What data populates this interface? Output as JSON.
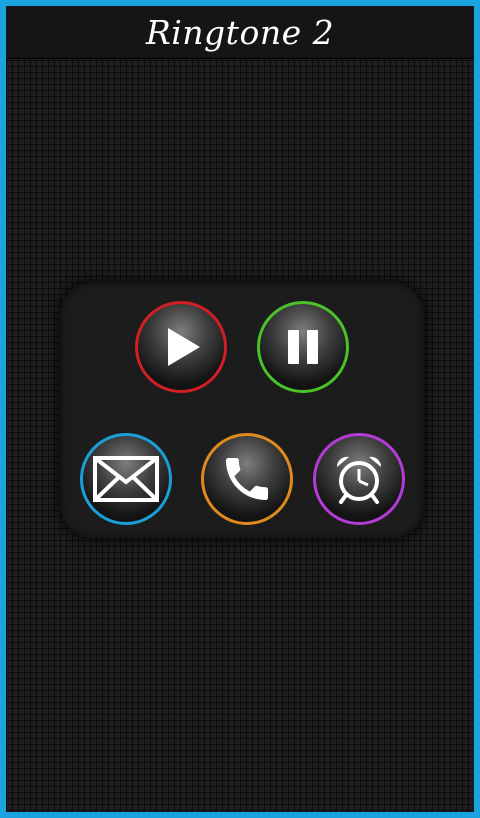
{
  "header": {
    "title": "Ringtone 2"
  },
  "colors": {
    "frame_border": "#1aa3df",
    "play_ring": "#d11f26",
    "pause_ring": "#4bc22a",
    "message_ring": "#1a9fd8",
    "call_ring": "#e08a1e",
    "alarm_ring": "#b33bd6"
  },
  "controls": [
    {
      "name": "play-button",
      "icon": "play-icon"
    },
    {
      "name": "pause-button",
      "icon": "pause-icon"
    },
    {
      "name": "set-message-tone-button",
      "icon": "envelope-icon"
    },
    {
      "name": "set-ringtone-button",
      "icon": "phone-icon"
    },
    {
      "name": "set-alarm-button",
      "icon": "alarm-clock-icon"
    }
  ]
}
